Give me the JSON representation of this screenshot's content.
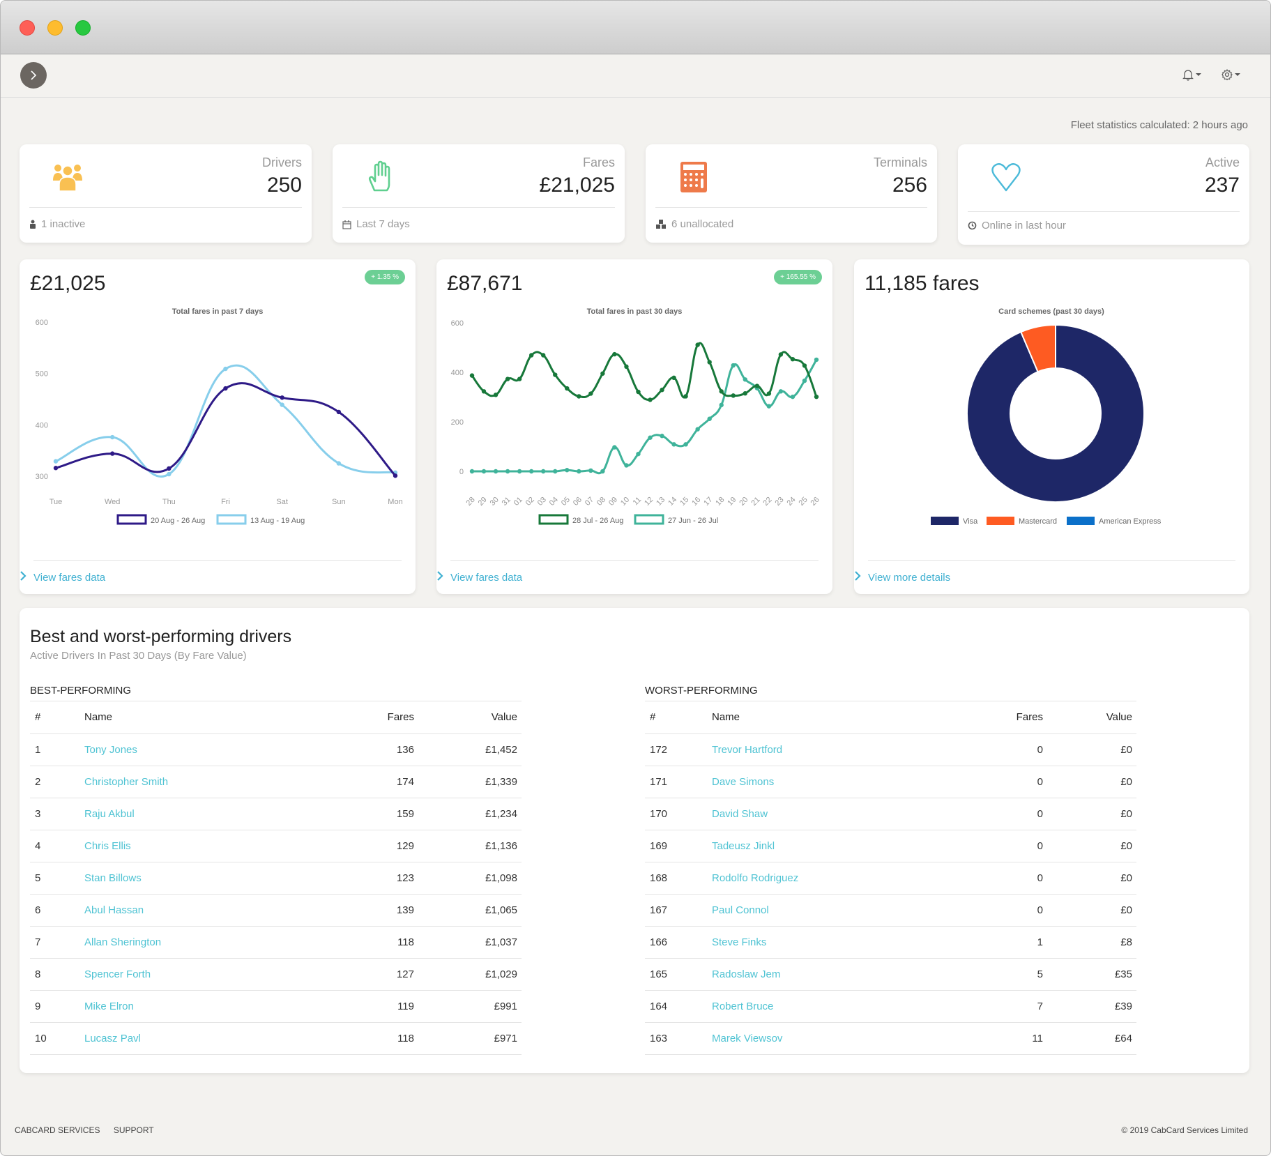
{
  "window": {
    "controls": [
      "close",
      "minimize",
      "maximize"
    ]
  },
  "toolbar": {
    "toggle_icon": "chevron-right-icon",
    "notifications_icon": "bell-icon",
    "settings_icon": "gear-icon"
  },
  "stats_note": "Fleet statistics calculated: 2 hours ago",
  "stat_cards": [
    {
      "label": "Drivers",
      "value": "250",
      "footer": "1 inactive",
      "icon": "users-icon",
      "footer_icon": "user-lock-icon",
      "color": "#f9c052"
    },
    {
      "label": "Fares",
      "value": "£21,025",
      "footer": "Last 7 days",
      "icon": "hand-icon",
      "footer_icon": "calendar-icon",
      "color": "#5fcf8f"
    },
    {
      "label": "Terminals",
      "value": "256",
      "footer": "6 unallocated",
      "icon": "calculator-icon",
      "footer_icon": "cubes-icon",
      "color": "#ee7a4a"
    },
    {
      "label": "Active",
      "value": "237",
      "footer": "Online in last hour",
      "icon": "heart-icon",
      "footer_icon": "clock-icon",
      "color": "#4bbad9"
    }
  ],
  "chart_cards": [
    {
      "big": "£21,025",
      "badge": "+ 1.35 %",
      "link": "View fares data"
    },
    {
      "big": "£87,671",
      "badge": "+ 165.55 %",
      "link": "View fares data"
    },
    {
      "big": "11,185 fares",
      "link": "View more details"
    }
  ],
  "chart_data": [
    {
      "type": "line",
      "title": "Total fares in past 7 days",
      "categories": [
        "Tue",
        "Wed",
        "Thu",
        "Fri",
        "Sat",
        "Sun",
        "Mon"
      ],
      "ylim": [
        270,
        600
      ],
      "yticks": [
        300,
        400,
        500,
        600
      ],
      "legend": "bottom",
      "series": [
        {
          "name": "20 Aug - 26 Aug",
          "color": "#2e1a87",
          "values": [
            316,
            344,
            315,
            471,
            453,
            425,
            301
          ]
        },
        {
          "name": "13 Aug - 19 Aug",
          "color": "#87ceeb",
          "values": [
            329,
            376,
            304,
            509,
            439,
            325,
            307
          ]
        }
      ]
    },
    {
      "type": "line",
      "title": "Total fares in past 30 days",
      "categories": [
        "28",
        "29",
        "30",
        "31",
        "01",
        "02",
        "03",
        "04",
        "05",
        "06",
        "07",
        "08",
        "09",
        "10",
        "11",
        "12",
        "13",
        "14",
        "15",
        "16",
        "17",
        "18",
        "19",
        "20",
        "21",
        "22",
        "23",
        "24",
        "25",
        "26"
      ],
      "ylim": [
        -50,
        600
      ],
      "yticks": [
        0,
        200,
        400,
        600
      ],
      "legend": "bottom",
      "series": [
        {
          "name": "28 Jul - 26 Aug",
          "color": "#17783a",
          "values": [
            387,
            323,
            309,
            373,
            373,
            469,
            469,
            390,
            335,
            303,
            314,
            395,
            473,
            423,
            321,
            289,
            329,
            378,
            303,
            511,
            441,
            323,
            306,
            315,
            345,
            314,
            472,
            453,
            427,
            301
          ]
        },
        {
          "name": "27 Jun - 26 Jul",
          "color": "#3fb39a",
          "values": [
            0,
            0,
            0,
            0,
            0,
            0,
            0,
            0,
            5,
            0,
            3,
            0,
            97,
            24,
            70,
            136,
            143,
            109,
            109,
            170,
            212,
            268,
            428,
            371,
            336,
            263,
            323,
            301,
            366,
            451
          ]
        }
      ]
    },
    {
      "type": "pie",
      "title": "Card schemes (past 30 days)",
      "legend": "bottom",
      "categories": [
        "Visa",
        "Mastercard",
        "American Express"
      ],
      "values": [
        93.6,
        6.4,
        0
      ],
      "colors": [
        "#1e2767",
        "#fe5b22",
        "#0b70c9"
      ]
    }
  ],
  "drivers": {
    "title": "Best and worst-performing drivers",
    "subtitle": "Active Drivers In Past 30 Days (By Fare Value)",
    "columns": [
      "#",
      "Name",
      "Fares",
      "Value"
    ],
    "best": {
      "heading": "BEST-PERFORMING",
      "rows": [
        [
          "1",
          "Tony Jones",
          "136",
          "£1,452"
        ],
        [
          "2",
          "Christopher Smith",
          "174",
          "£1,339"
        ],
        [
          "3",
          "Raju Akbul",
          "159",
          "£1,234"
        ],
        [
          "4",
          "Chris Ellis",
          "129",
          "£1,136"
        ],
        [
          "5",
          "Stan Billows",
          "123",
          "£1,098"
        ],
        [
          "6",
          "Abul Hassan",
          "139",
          "£1,065"
        ],
        [
          "7",
          "Allan Sherington",
          "118",
          "£1,037"
        ],
        [
          "8",
          "Spencer Forth",
          "127",
          "£1,029"
        ],
        [
          "9",
          "Mike Elron",
          "119",
          "£991"
        ],
        [
          "10",
          "Lucasz Pavl",
          "118",
          "£971"
        ]
      ]
    },
    "worst": {
      "heading": "WORST-PERFORMING",
      "rows": [
        [
          "172",
          "Trevor Hartford",
          "0",
          "£0"
        ],
        [
          "171",
          "Dave Simons",
          "0",
          "£0"
        ],
        [
          "170",
          "David Shaw",
          "0",
          "£0"
        ],
        [
          "169",
          "Tadeusz Jinkl",
          "0",
          "£0"
        ],
        [
          "168",
          "Rodolfo Rodriguez",
          "0",
          "£0"
        ],
        [
          "167",
          "Paul Connol",
          "0",
          "£0"
        ],
        [
          "166",
          "Steve Finks",
          "1",
          "£8"
        ],
        [
          "165",
          "Radoslaw Jem",
          "5",
          "£35"
        ],
        [
          "164",
          "Robert Bruce",
          "7",
          "£39"
        ],
        [
          "163",
          "Marek Viewsov",
          "11",
          "£64"
        ]
      ]
    }
  },
  "footer": {
    "links": [
      "CABCARD SERVICES",
      "SUPPORT"
    ],
    "copyright": "© 2019 CabCard Services Limited"
  }
}
